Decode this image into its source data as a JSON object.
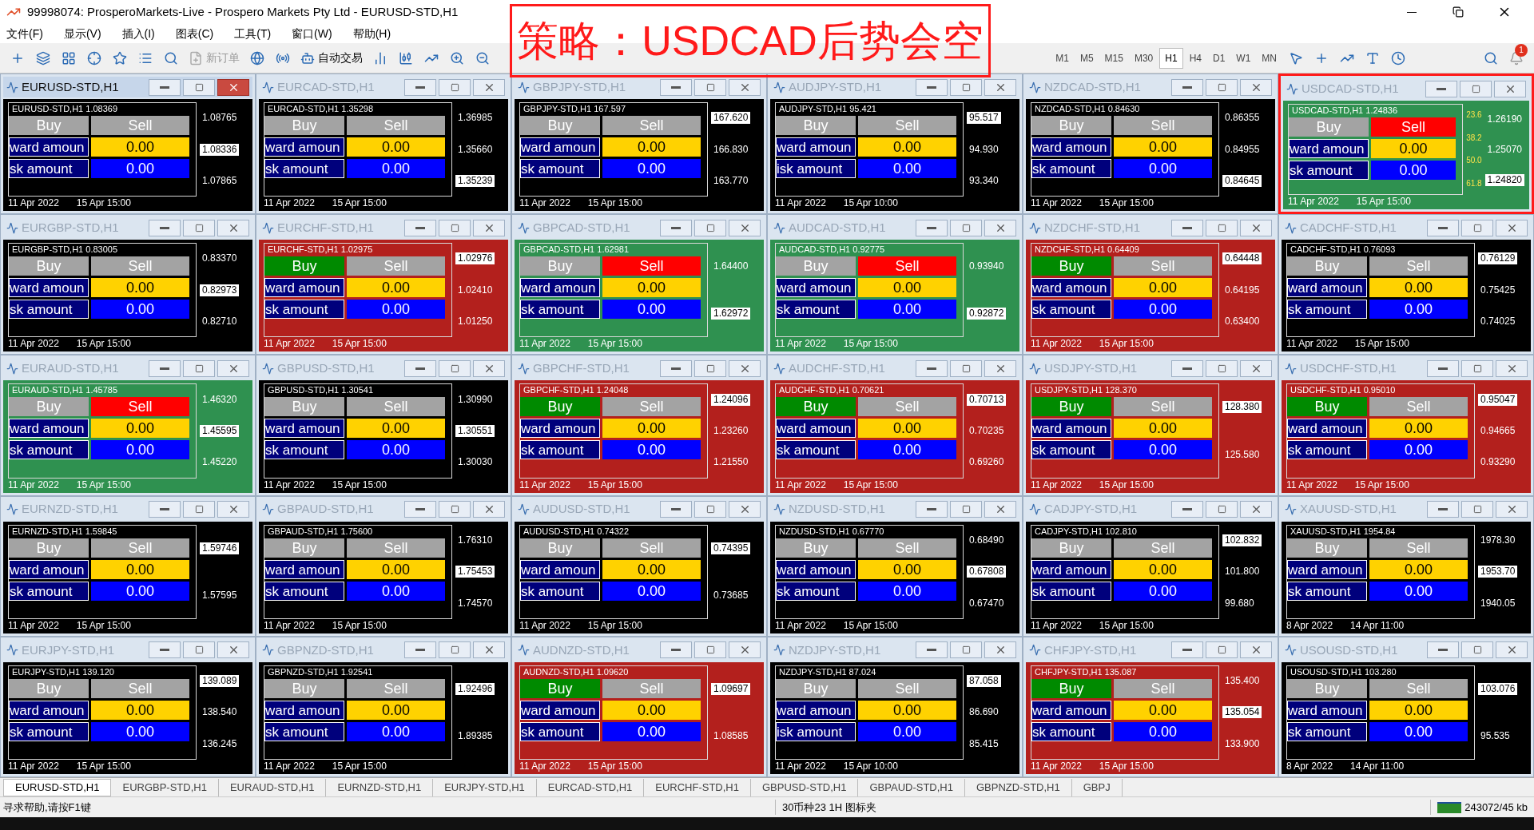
{
  "window": {
    "title": "99998074: ProsperoMarkets-Live - Prospero Markets Pty Ltd - EURUSD-STD,H1"
  },
  "menu": [
    "文件(F)",
    "显示(V)",
    "插入(I)",
    "图表(C)",
    "工具(T)",
    "窗口(W)",
    "帮助(H)"
  ],
  "toolbar": {
    "new_order": {
      "label": "新订单",
      "disabled": true
    },
    "auto_trading": {
      "label": "自动交易"
    },
    "timeframes": [
      {
        "label": "M1",
        "selected": false
      },
      {
        "label": "M5",
        "selected": false
      },
      {
        "label": "M15",
        "selected": false
      },
      {
        "label": "M30",
        "selected": false
      },
      {
        "label": "H1",
        "selected": true
      },
      {
        "label": "H4",
        "selected": false
      },
      {
        "label": "D1",
        "selected": false
      },
      {
        "label": "W1",
        "selected": false
      },
      {
        "label": "MN",
        "selected": false
      }
    ],
    "notifications": "1"
  },
  "annotation": {
    "text": "策略：USDCAD后势会空"
  },
  "charts": [
    {
      "title": "EURUSD-STD,H1",
      "active": true,
      "color": "#000000",
      "highlighted": false,
      "info": "EURUSD-STD,H1 1.08369",
      "buy": {
        "label": "Buy",
        "active": false
      },
      "sell": {
        "label": "Sell",
        "active": false
      },
      "reward_label": "ward amoun",
      "reward": "0.00",
      "risk_label": "sk amount",
      "risk": "0.00",
      "prices": [
        {
          "value": "1.08765",
          "current": false
        },
        {
          "value": "1.08336",
          "current": true
        },
        {
          "value": "1.07865",
          "current": false
        }
      ],
      "dates": [
        "11 Apr 2022",
        "15 Apr 15:00"
      ]
    },
    {
      "title": "EURCAD-STD,H1",
      "active": false,
      "color": "#000000",
      "highlighted": false,
      "info": "EURCAD-STD,H1 1.35298",
      "buy": {
        "label": "Buy",
        "active": false
      },
      "sell": {
        "label": "Sell",
        "active": false
      },
      "reward_label": "ward amoun",
      "reward": "0.00",
      "risk_label": "sk amount",
      "risk": "0.00",
      "prices": [
        {
          "value": "1.36985",
          "current": false
        },
        {
          "value": "1.35660",
          "current": false
        },
        {
          "value": "1.35239",
          "current": true
        }
      ],
      "dates": [
        "11 Apr 2022",
        "15 Apr 15:00"
      ]
    },
    {
      "title": "GBPJPY-STD,H1",
      "active": false,
      "color": "#000000",
      "highlighted": false,
      "info": "GBPJPY-STD,H1 167.597",
      "buy": {
        "label": "Buy",
        "active": false
      },
      "sell": {
        "label": "Sell",
        "active": false
      },
      "reward_label": "ward amoun",
      "reward": "0.00",
      "risk_label": "sk amount",
      "risk": "0.00",
      "prices": [
        {
          "value": "167.620",
          "current": true
        },
        {
          "value": "166.830",
          "current": false
        },
        {
          "value": "163.770",
          "current": false
        }
      ],
      "dates": [
        "11 Apr 2022",
        "15 Apr 15:00"
      ]
    },
    {
      "title": "AUDJPY-STD,H1",
      "active": false,
      "color": "#000000",
      "highlighted": false,
      "info": "AUDJPY-STD,H1 95.421",
      "buy": {
        "label": "Buy",
        "active": false
      },
      "sell": {
        "label": "Sell",
        "active": false
      },
      "reward_label": "ward amoun",
      "reward": "0.00",
      "risk_label": "isk amount",
      "risk": "0.00",
      "prices": [
        {
          "value": "95.517",
          "current": true
        },
        {
          "value": "94.930",
          "current": false
        },
        {
          "value": "93.340",
          "current": false
        }
      ],
      "dates": [
        "11 Apr 2022",
        "15 Apr 10:00"
      ]
    },
    {
      "title": "NZDCAD-STD,H1",
      "active": false,
      "color": "#000000",
      "highlighted": false,
      "info": "NZDCAD-STD,H1 0.84630",
      "buy": {
        "label": "Buy",
        "active": false
      },
      "sell": {
        "label": "Sell",
        "active": false
      },
      "reward_label": "ward amoun",
      "reward": "0.00",
      "risk_label": "sk amount",
      "risk": "0.00",
      "prices": [
        {
          "value": "0.86355",
          "current": false
        },
        {
          "value": "0.84955",
          "current": false
        },
        {
          "value": "0.84645",
          "current": true
        }
      ],
      "dates": [
        "11 Apr 2022",
        "15 Apr 15:00"
      ]
    },
    {
      "title": "USDCAD-STD,H1",
      "active": false,
      "color": "#2f9150",
      "highlighted": true,
      "info": "USDCAD-STD,H1 1.24836",
      "buy": {
        "label": "Buy",
        "active": false
      },
      "sell": {
        "label": "Sell",
        "active": true
      },
      "reward_label": "ward amoun",
      "reward": "0.00",
      "risk_label": "sk amount",
      "risk": "0.00",
      "fib_levels": [
        "23.6",
        "38.2",
        "50.0",
        "61.8"
      ],
      "prices": [
        {
          "value": "1.26190",
          "current": false
        },
        {
          "value": "1.25070",
          "current": false
        },
        {
          "value": "1.24820",
          "current": true
        }
      ],
      "dates": [
        "11 Apr 2022",
        "15 Apr 15:00"
      ]
    },
    {
      "title": "EURGBP-STD,H1",
      "active": false,
      "color": "#000000",
      "highlighted": false,
      "info": "EURGBP-STD,H1 0.83005",
      "buy": {
        "label": "Buy",
        "active": false
      },
      "sell": {
        "label": "Sell",
        "active": false
      },
      "reward_label": "ward amoun",
      "reward": "0.00",
      "risk_label": "sk amount",
      "risk": "0.00",
      "prices": [
        {
          "value": "0.83370",
          "current": false
        },
        {
          "value": "0.82973",
          "current": true
        },
        {
          "value": "0.82710",
          "current": false
        }
      ],
      "dates": [
        "11 Apr 2022",
        "15 Apr 15:00"
      ]
    },
    {
      "title": "EURCHF-STD,H1",
      "active": false,
      "color": "#b3201d",
      "highlighted": false,
      "info": "EURCHF-STD,H1 1.02975",
      "buy": {
        "label": "Buy",
        "active": true
      },
      "sell": {
        "label": "Sell",
        "active": false
      },
      "reward_label": "ward amoun",
      "reward": "0.00",
      "risk_label": "sk amount",
      "risk": "0.00",
      "prices": [
        {
          "value": "1.02976",
          "current": true
        },
        {
          "value": "1.02410",
          "current": false
        },
        {
          "value": "1.01250",
          "current": false
        }
      ],
      "dates": [
        "11 Apr 2022",
        "15 Apr 15:00"
      ]
    },
    {
      "title": "GBPCAD-STD,H1",
      "active": false,
      "color": "#2f9150",
      "highlighted": false,
      "info": "GBPCAD-STD,H1 1.62981",
      "buy": {
        "label": "Buy",
        "active": false
      },
      "sell": {
        "label": "Sell",
        "active": true
      },
      "reward_label": "ward amoun",
      "reward": "0.00",
      "risk_label": "sk amount",
      "risk": "0.00",
      "prices": [
        {
          "value": "1.64400",
          "current": false
        },
        {
          "value": "1.62972",
          "current": true
        }
      ],
      "dates": [
        "11 Apr 2022",
        "15 Apr 15:00"
      ]
    },
    {
      "title": "AUDCAD-STD,H1",
      "active": false,
      "color": "#2f9150",
      "highlighted": false,
      "info": "AUDCAD-STD,H1 0.92775",
      "buy": {
        "label": "Buy",
        "active": false
      },
      "sell": {
        "label": "Sell",
        "active": true
      },
      "reward_label": "ward amoun",
      "reward": "0.00",
      "risk_label": "sk amount",
      "risk": "0.00",
      "prices": [
        {
          "value": "0.93940",
          "current": false
        },
        {
          "value": "0.92872",
          "current": true
        }
      ],
      "dates": [
        "11 Apr 2022",
        "15 Apr 15:00"
      ]
    },
    {
      "title": "NZDCHF-STD,H1",
      "active": false,
      "color": "#b3201d",
      "highlighted": false,
      "info": "NZDCHF-STD,H1 0.64409",
      "buy": {
        "label": "Buy",
        "active": true
      },
      "sell": {
        "label": "Sell",
        "active": false
      },
      "reward_label": "ward amoun",
      "reward": "0.00",
      "risk_label": "sk amount",
      "risk": "0.00",
      "prices": [
        {
          "value": "0.64448",
          "current": true
        },
        {
          "value": "0.64195",
          "current": false
        },
        {
          "value": "0.63400",
          "current": false
        }
      ],
      "dates": [
        "11 Apr 2022",
        "15 Apr 15:00"
      ]
    },
    {
      "title": "CADCHF-STD,H1",
      "active": false,
      "color": "#000000",
      "highlighted": false,
      "info": "CADCHF-STD,H1 0.76093",
      "buy": {
        "label": "Buy",
        "active": false
      },
      "sell": {
        "label": "Sell",
        "active": false
      },
      "reward_label": "ward amoun",
      "reward": "0.00",
      "risk_label": "sk amount",
      "risk": "0.00",
      "prices": [
        {
          "value": "0.76129",
          "current": true
        },
        {
          "value": "0.75425",
          "current": false
        },
        {
          "value": "0.74025",
          "current": false
        }
      ],
      "dates": [
        "11 Apr 2022",
        "15 Apr 15:00"
      ]
    },
    {
      "title": "EURAUD-STD,H1",
      "active": false,
      "color": "#2f9150",
      "highlighted": false,
      "info": "EURAUD-STD,H1 1.45785",
      "buy": {
        "label": "Buy",
        "active": false
      },
      "sell": {
        "label": "Sell",
        "active": true
      },
      "reward_label": "ward amoun",
      "reward": "0.00",
      "risk_label": "sk amount",
      "risk": "0.00",
      "prices": [
        {
          "value": "1.46320",
          "current": false
        },
        {
          "value": "1.45595",
          "current": true
        },
        {
          "value": "1.45220",
          "current": false
        }
      ],
      "dates": [
        "11 Apr 2022",
        "15 Apr 15:00"
      ]
    },
    {
      "title": "GBPUSD-STD,H1",
      "active": false,
      "color": "#000000",
      "highlighted": false,
      "info": "GBPUSD-STD,H1 1.30541",
      "buy": {
        "label": "Buy",
        "active": false
      },
      "sell": {
        "label": "Sell",
        "active": false
      },
      "reward_label": "ward amoun",
      "reward": "0.00",
      "risk_label": "sk amount",
      "risk": "0.00",
      "prices": [
        {
          "value": "1.30990",
          "current": false
        },
        {
          "value": "1.30551",
          "current": true
        },
        {
          "value": "1.30030",
          "current": false
        }
      ],
      "dates": [
        "11 Apr 2022",
        "15 Apr 15:00"
      ]
    },
    {
      "title": "GBPCHF-STD,H1",
      "active": false,
      "color": "#b3201d",
      "highlighted": false,
      "info": "GBPCHF-STD,H1 1.24048",
      "buy": {
        "label": "Buy",
        "active": true
      },
      "sell": {
        "label": "Sell",
        "active": false
      },
      "reward_label": "ward amoun",
      "reward": "0.00",
      "risk_label": "sk amount",
      "risk": "0.00",
      "prices": [
        {
          "value": "1.24096",
          "current": true
        },
        {
          "value": "1.23260",
          "current": false
        },
        {
          "value": "1.21550",
          "current": false
        }
      ],
      "dates": [
        "11 Apr 2022",
        "15 Apr 15:00"
      ]
    },
    {
      "title": "AUDCHF-STD,H1",
      "active": false,
      "color": "#b3201d",
      "highlighted": false,
      "info": "AUDCHF-STD,H1 0.70621",
      "buy": {
        "label": "Buy",
        "active": true
      },
      "sell": {
        "label": "Sell",
        "active": false
      },
      "reward_label": "ward amoun",
      "reward": "0.00",
      "risk_label": "sk amount",
      "risk": "0.00",
      "prices": [
        {
          "value": "0.70713",
          "current": true
        },
        {
          "value": "0.70235",
          "current": false
        },
        {
          "value": "0.69260",
          "current": false
        }
      ],
      "dates": [
        "11 Apr 2022",
        "15 Apr 15:00"
      ]
    },
    {
      "title": "USDJPY-STD,H1",
      "active": false,
      "color": "#b3201d",
      "highlighted": false,
      "info": "USDJPY-STD,H1 128.370",
      "buy": {
        "label": "Buy",
        "active": true
      },
      "sell": {
        "label": "Sell",
        "active": false
      },
      "reward_label": "ward amoun",
      "reward": "0.00",
      "risk_label": "sk amount",
      "risk": "0.00",
      "prices": [
        {
          "value": "128.380",
          "current": true
        },
        {
          "value": "125.580",
          "current": false
        }
      ],
      "dates": [
        "11 Apr 2022",
        "15 Apr 15:00"
      ]
    },
    {
      "title": "USDCHF-STD,H1",
      "active": false,
      "color": "#b3201d",
      "highlighted": false,
      "info": "USDCHF-STD,H1 0.95010",
      "buy": {
        "label": "Buy",
        "active": true
      },
      "sell": {
        "label": "Sell",
        "active": false
      },
      "reward_label": "ward amoun",
      "reward": "0.00",
      "risk_label": "sk amount",
      "risk": "0.00",
      "prices": [
        {
          "value": "0.95047",
          "current": true
        },
        {
          "value": "0.94665",
          "current": false
        },
        {
          "value": "0.93290",
          "current": false
        }
      ],
      "dates": [
        "11 Apr 2022",
        "15 Apr 15:00"
      ]
    },
    {
      "title": "EURNZD-STD,H1",
      "active": false,
      "color": "#000000",
      "highlighted": false,
      "info": "EURNZD-STD,H1 1.59845",
      "buy": {
        "label": "Buy",
        "active": false
      },
      "sell": {
        "label": "Sell",
        "active": false
      },
      "reward_label": "ward amoun",
      "reward": "0.00",
      "risk_label": "sk amount",
      "risk": "0.00",
      "prices": [
        {
          "value": "1.59746",
          "current": true
        },
        {
          "value": "1.57595",
          "current": false
        }
      ],
      "dates": [
        "11 Apr 2022",
        "15 Apr 15:00"
      ]
    },
    {
      "title": "GBPAUD-STD,H1",
      "active": false,
      "color": "#000000",
      "highlighted": false,
      "info": "GBPAUD-STD,H1 1.75600",
      "buy": {
        "label": "Buy",
        "active": false
      },
      "sell": {
        "label": "Sell",
        "active": false
      },
      "reward_label": "ward amoun",
      "reward": "0.00",
      "risk_label": "sk amount",
      "risk": "0.00",
      "prices": [
        {
          "value": "1.76310",
          "current": false
        },
        {
          "value": "1.75453",
          "current": true
        },
        {
          "value": "1.74570",
          "current": false
        }
      ],
      "dates": [
        "11 Apr 2022",
        "15 Apr 15:00"
      ]
    },
    {
      "title": "AUDUSD-STD,H1",
      "active": false,
      "color": "#000000",
      "highlighted": false,
      "info": "AUDUSD-STD,H1 0.74322",
      "buy": {
        "label": "Buy",
        "active": false
      },
      "sell": {
        "label": "Sell",
        "active": false
      },
      "reward_label": "ward amoun",
      "reward": "0.00",
      "risk_label": "sk amount",
      "risk": "0.00",
      "prices": [
        {
          "value": "0.74395",
          "current": true
        },
        {
          "value": "0.73685",
          "current": false
        }
      ],
      "dates": [
        "11 Apr 2022",
        "15 Apr 15:00"
      ]
    },
    {
      "title": "NZDUSD-STD,H1",
      "active": false,
      "color": "#000000",
      "highlighted": false,
      "info": "NZDUSD-STD,H1 0.67770",
      "buy": {
        "label": "Buy",
        "active": false
      },
      "sell": {
        "label": "Sell",
        "active": false
      },
      "reward_label": "ward amoun",
      "reward": "0.00",
      "risk_label": "sk amount",
      "risk": "0.00",
      "prices": [
        {
          "value": "0.68490",
          "current": false
        },
        {
          "value": "0.67808",
          "current": true
        },
        {
          "value": "0.67470",
          "current": false
        }
      ],
      "dates": [
        "11 Apr 2022",
        "15 Apr 15:00"
      ]
    },
    {
      "title": "CADJPY-STD,H1",
      "active": false,
      "color": "#000000",
      "highlighted": false,
      "info": "CADJPY-STD,H1 102.810",
      "buy": {
        "label": "Buy",
        "active": false
      },
      "sell": {
        "label": "Sell",
        "active": false
      },
      "reward_label": "ward amoun",
      "reward": "0.00",
      "risk_label": "sk amount",
      "risk": "0.00",
      "prices": [
        {
          "value": "102.832",
          "current": true
        },
        {
          "value": "101.800",
          "current": false
        },
        {
          "value": "99.680",
          "current": false
        }
      ],
      "dates": [
        "11 Apr 2022",
        "15 Apr 15:00"
      ]
    },
    {
      "title": "XAUUSD-STD,H1",
      "active": false,
      "color": "#000000",
      "highlighted": false,
      "info": "XAUUSD-STD,H1 1954.84",
      "buy": {
        "label": "Buy",
        "active": false
      },
      "sell": {
        "label": "Sell",
        "active": false
      },
      "reward_label": "ward amoun",
      "reward": "0.00",
      "risk_label": "sk amount",
      "risk": "0.00",
      "prices": [
        {
          "value": "1978.30",
          "current": false
        },
        {
          "value": "1953.70",
          "current": true
        },
        {
          "value": "1940.05",
          "current": false
        }
      ],
      "dates": [
        "8 Apr 2022",
        "14 Apr 11:00"
      ]
    },
    {
      "title": "EURJPY-STD,H1",
      "active": false,
      "color": "#000000",
      "highlighted": false,
      "info": "EURJPY-STD,H1 139.120",
      "buy": {
        "label": "Buy",
        "active": false
      },
      "sell": {
        "label": "Sell",
        "active": false
      },
      "reward_label": "ward amoun",
      "reward": "0.00",
      "risk_label": "sk amount",
      "risk": "0.00",
      "prices": [
        {
          "value": "139.089",
          "current": true
        },
        {
          "value": "138.540",
          "current": false
        },
        {
          "value": "136.245",
          "current": false
        }
      ],
      "dates": [
        "11 Apr 2022",
        "15 Apr 15:00"
      ]
    },
    {
      "title": "GBPNZD-STD,H1",
      "active": false,
      "color": "#000000",
      "highlighted": false,
      "info": "GBPNZD-STD,H1 1.92541",
      "buy": {
        "label": "Buy",
        "active": false
      },
      "sell": {
        "label": "Sell",
        "active": false
      },
      "reward_label": "ward amoun",
      "reward": "0.00",
      "risk_label": "sk amount",
      "risk": "0.00",
      "prices": [
        {
          "value": "1.92496",
          "current": true
        },
        {
          "value": "1.89385",
          "current": false
        }
      ],
      "dates": [
        "11 Apr 2022",
        "15 Apr 15:00"
      ]
    },
    {
      "title": "AUDNZD-STD,H1",
      "active": false,
      "color": "#b3201d",
      "highlighted": false,
      "info": "AUDNZD-STD,H1 1.09620",
      "buy": {
        "label": "Buy",
        "active": true
      },
      "sell": {
        "label": "Sell",
        "active": false
      },
      "reward_label": "ward amoun",
      "reward": "0.00",
      "risk_label": "sk amount",
      "risk": "0.00",
      "prices": [
        {
          "value": "1.09697",
          "current": true
        },
        {
          "value": "1.08585",
          "current": false
        }
      ],
      "dates": [
        "11 Apr 2022",
        "15 Apr 15:00"
      ]
    },
    {
      "title": "NZDJPY-STD,H1",
      "active": false,
      "color": "#000000",
      "highlighted": false,
      "info": "NZDJPY-STD,H1 87.024",
      "buy": {
        "label": "Buy",
        "active": false
      },
      "sell": {
        "label": "Sell",
        "active": false
      },
      "reward_label": "ward amoun",
      "reward": "0.00",
      "risk_label": "isk amount",
      "risk": "0.00",
      "prices": [
        {
          "value": "87.058",
          "current": true
        },
        {
          "value": "86.690",
          "current": false
        },
        {
          "value": "85.415",
          "current": false
        }
      ],
      "dates": [
        "11 Apr 2022",
        "15 Apr 10:00"
      ]
    },
    {
      "title": "CHFJPY-STD,H1",
      "active": false,
      "color": "#b3201d",
      "highlighted": false,
      "info": "CHFJPY-STD,H1 135.087",
      "buy": {
        "label": "Buy",
        "active": true
      },
      "sell": {
        "label": "Sell",
        "active": false
      },
      "reward_label": "ward amoun",
      "reward": "0.00",
      "risk_label": "sk amount",
      "risk": "0.00",
      "prices": [
        {
          "value": "135.400",
          "current": false
        },
        {
          "value": "135.054",
          "current": true
        },
        {
          "value": "133.900",
          "current": false
        }
      ],
      "dates": [
        "11 Apr 2022",
        "15 Apr 15:00"
      ]
    },
    {
      "title": "USOUSD-STD,H1",
      "active": false,
      "color": "#000000",
      "highlighted": false,
      "info": "USOUSD-STD,H1 103.280",
      "buy": {
        "label": "Buy",
        "active": false
      },
      "sell": {
        "label": "Sell",
        "active": false
      },
      "reward_label": "ward amoun",
      "reward": "0.00",
      "risk_label": "sk amount",
      "risk": "0.00",
      "prices": [
        {
          "value": "103.076",
          "current": true
        },
        {
          "value": "95.535",
          "current": false
        }
      ],
      "dates": [
        "8 Apr 2022",
        "14 Apr 11:00"
      ]
    }
  ],
  "tabs": [
    {
      "label": "EURUSD-STD,H1",
      "selected": true
    },
    {
      "label": "EURGBP-STD,H1",
      "selected": false
    },
    {
      "label": "EURAUD-STD,H1",
      "selected": false
    },
    {
      "label": "EURNZD-STD,H1",
      "selected": false
    },
    {
      "label": "EURJPY-STD,H1",
      "selected": false
    },
    {
      "label": "EURCAD-STD,H1",
      "selected": false
    },
    {
      "label": "EURCHF-STD,H1",
      "selected": false
    },
    {
      "label": "GBPUSD-STD,H1",
      "selected": false
    },
    {
      "label": "GBPAUD-STD,H1",
      "selected": false
    },
    {
      "label": "GBPNZD-STD,H1",
      "selected": false
    },
    {
      "label": "GBPJ",
      "selected": false
    }
  ],
  "status_bar": {
    "help": "寻求帮助,请按F1键",
    "profile": "30币种23 1H 图标夹",
    "traffic": "243072/45 kb"
  }
}
